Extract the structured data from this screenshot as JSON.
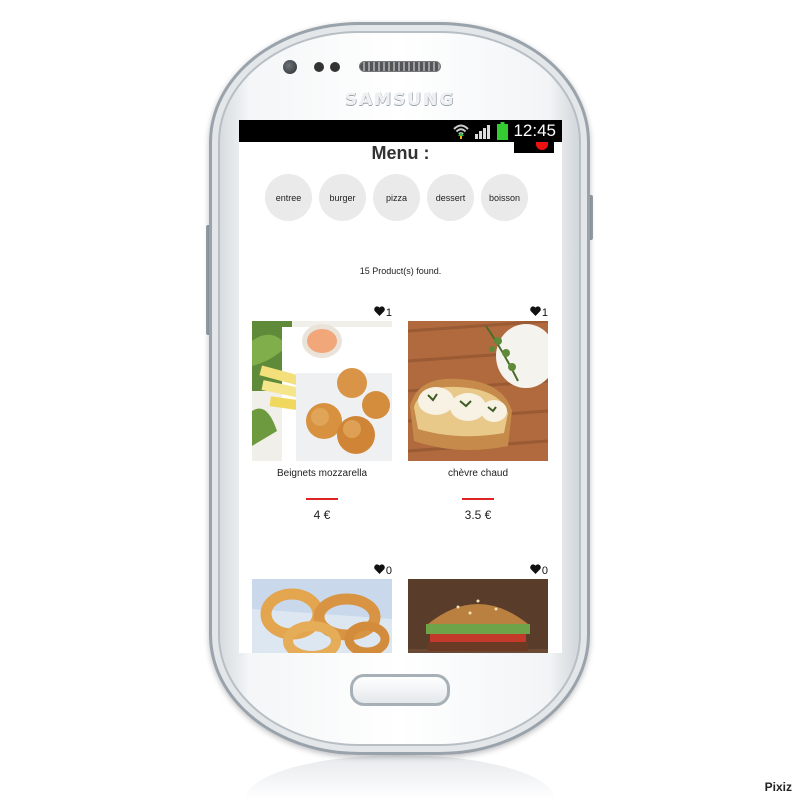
{
  "device": {
    "brand": "SAMSUNG"
  },
  "status_bar": {
    "time": "12:45",
    "icons": [
      "wifi-icon",
      "signal-icon",
      "battery-icon"
    ],
    "battery_color": "#33cc33"
  },
  "app": {
    "title": "Menu :",
    "categories": [
      "entree",
      "burger",
      "pizza",
      "dessert",
      "boisson"
    ],
    "results_text": "15 Product(s) found.",
    "accent_color": "#e02424",
    "products": [
      {
        "name": "Beignets mozzarella",
        "price": "4 €",
        "likes": "1"
      },
      {
        "name": "chèvre chaud",
        "price": "3.5 €",
        "likes": "1"
      },
      {
        "name": "",
        "price": "",
        "likes": "0"
      },
      {
        "name": "",
        "price": "",
        "likes": "0"
      }
    ]
  },
  "watermark": "Pixiz"
}
